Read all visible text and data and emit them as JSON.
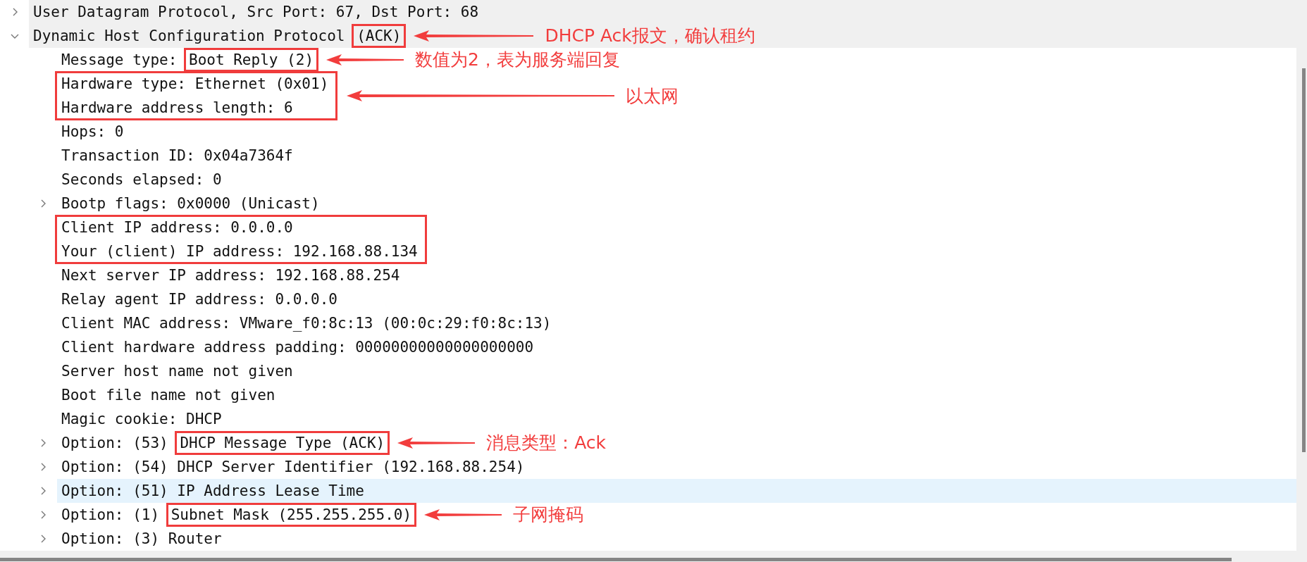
{
  "tree": [
    {
      "kind": "node",
      "text": "User Datagram Protocol, Src Port: 67, Dst Port: 68",
      "expanded": false,
      "selected": true,
      "hovered": false
    },
    {
      "kind": "node",
      "text": "Dynamic Host Configuration Protocol ",
      "boxed": "(ACK)",
      "note": "DHCP Ack报文，确认租约",
      "expanded": true,
      "selected": true,
      "hovered": false,
      "children": [
        {
          "kind": "leaf",
          "text": "Message type: ",
          "boxed": "Boot Reply (2)",
          "note": "数值为2，表为服务端回复",
          "selected": false,
          "hovered": false
        },
        {
          "kind": "box_group",
          "note": "以太网",
          "rows": [
            {
              "text": "Hardware type: Ethernet (0x01)",
              "selected": false,
              "hovered": false
            },
            {
              "text": "Hardware address length: 6",
              "selected": false,
              "hovered": false
            }
          ]
        },
        {
          "kind": "leaf",
          "text": "Hops: 0",
          "selected": false,
          "hovered": false
        },
        {
          "kind": "leaf",
          "text": "Transaction ID: 0x04a7364f",
          "selected": false,
          "hovered": false
        },
        {
          "kind": "leaf",
          "text": "Seconds elapsed: 0",
          "selected": false,
          "hovered": false
        },
        {
          "kind": "node",
          "text": "Bootp flags: 0x0000 (Unicast)",
          "expanded": false,
          "selected": false,
          "hovered": false
        },
        {
          "kind": "box_group",
          "rows": [
            {
              "text": "Client IP address: 0.0.0.0",
              "selected": false,
              "hovered": false
            },
            {
              "text": "Your (client) IP address: 192.168.88.134",
              "selected": false,
              "hovered": false
            }
          ]
        },
        {
          "kind": "leaf",
          "text": "Next server IP address: 192.168.88.254",
          "selected": false,
          "hovered": false
        },
        {
          "kind": "leaf",
          "text": "Relay agent IP address: 0.0.0.0",
          "selected": false,
          "hovered": false
        },
        {
          "kind": "leaf",
          "text": "Client MAC address: VMware_f0:8c:13 (00:0c:29:f0:8c:13)",
          "selected": false,
          "hovered": false
        },
        {
          "kind": "leaf",
          "text": "Client hardware address padding: 00000000000000000000",
          "selected": false,
          "hovered": false
        },
        {
          "kind": "leaf",
          "text": "Server host name not given",
          "selected": false,
          "hovered": false
        },
        {
          "kind": "leaf",
          "text": "Boot file name not given",
          "selected": false,
          "hovered": false
        },
        {
          "kind": "leaf",
          "text": "Magic cookie: DHCP",
          "selected": false,
          "hovered": false
        },
        {
          "kind": "node",
          "text": "Option: (53) ",
          "boxed": "DHCP Message Type (ACK)",
          "note": "消息类型：Ack",
          "expanded": false,
          "selected": false,
          "hovered": false
        },
        {
          "kind": "node",
          "text": "Option: (54) DHCP Server Identifier (192.168.88.254)",
          "expanded": false,
          "selected": false,
          "hovered": false
        },
        {
          "kind": "node",
          "text": "Option: (51) IP Address Lease Time",
          "expanded": false,
          "selected": false,
          "hovered": true
        },
        {
          "kind": "node",
          "text": "Option: (1) ",
          "boxed": "Subnet Mask (255.255.255.0)",
          "note": "子网掩码",
          "expanded": false,
          "selected": false,
          "hovered": false
        },
        {
          "kind": "node",
          "text": "Option: (3) Router",
          "expanded": false,
          "selected": false,
          "hovered": false
        }
      ]
    }
  ]
}
